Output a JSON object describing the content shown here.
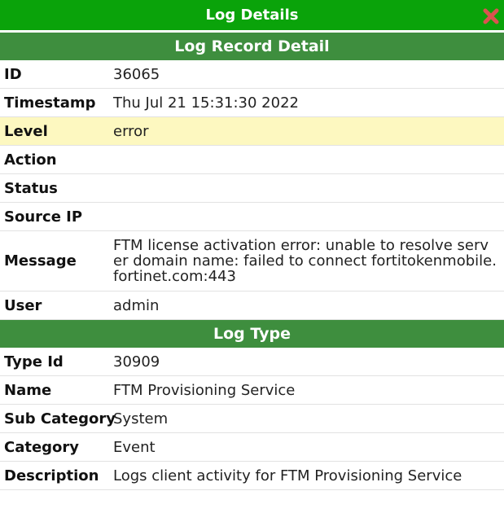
{
  "dialog": {
    "title": "Log Details",
    "colors": {
      "titlebar": "#0aa30a",
      "section_header": "#3e8e3e",
      "highlight_row": "#fdf8c0",
      "close_icon": "#d9534f"
    }
  },
  "record": {
    "header": "Log Record Detail",
    "rows": [
      {
        "label": "ID",
        "value": "36065"
      },
      {
        "label": "Timestamp",
        "value": "Thu Jul 21 15:31:30 2022"
      },
      {
        "label": "Level",
        "value": "error"
      },
      {
        "label": "Action",
        "value": ""
      },
      {
        "label": "Status",
        "value": ""
      },
      {
        "label": "Source IP",
        "value": ""
      },
      {
        "label": "Message",
        "value": "FTM license activation error: unable to resolve server domain name: failed to connect fortitokenmobile.fortinet.com:443"
      },
      {
        "label": "User",
        "value": "admin"
      }
    ]
  },
  "log_type": {
    "header": "Log Type",
    "rows": [
      {
        "label": "Type Id",
        "value": "30909"
      },
      {
        "label": "Name",
        "value": "FTM Provisioning Service"
      },
      {
        "label": "Sub Category",
        "value": "System"
      },
      {
        "label": "Category",
        "value": "Event"
      },
      {
        "label": "Description",
        "value": "Logs client activity for FTM Provisioning Service"
      }
    ]
  }
}
